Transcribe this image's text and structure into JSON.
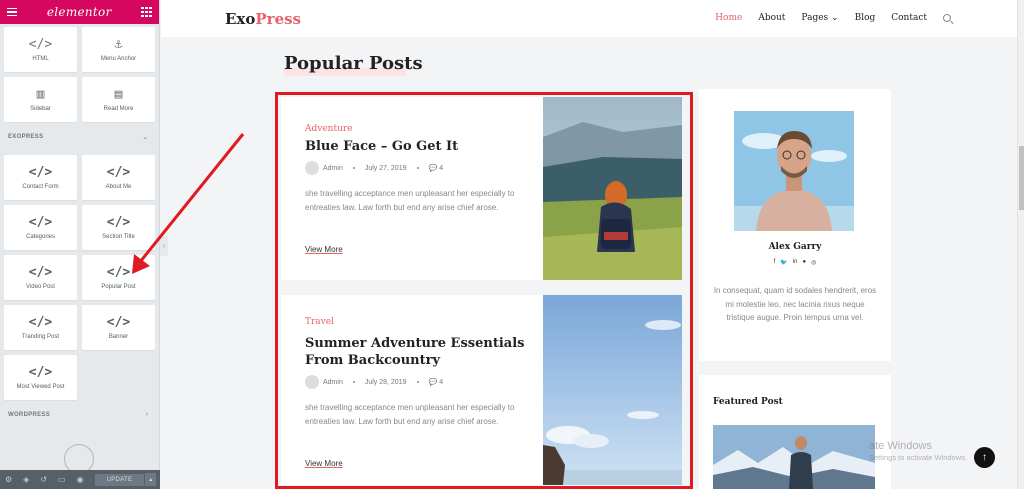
{
  "elementor": {
    "logo": "elementor",
    "top_widgets": [
      {
        "label": "HTML",
        "icon": "code-brackets-icon",
        "glyph": "</>"
      },
      {
        "label": "Menu Anchor",
        "icon": "anchor-icon",
        "glyph": "⚓"
      },
      {
        "label": "Sidebar",
        "icon": "sidebar-icon",
        "glyph": "▥"
      },
      {
        "label": "Read More",
        "icon": "document-icon",
        "glyph": "▤"
      }
    ],
    "category": "EXOPRESS",
    "widgets": [
      {
        "label": "Contact Form",
        "icon": "code-icon",
        "glyph": "</>"
      },
      {
        "label": "About Me",
        "icon": "code-icon",
        "glyph": "</>"
      },
      {
        "label": "Categories",
        "icon": "code-icon",
        "glyph": "</>"
      },
      {
        "label": "Section Title",
        "icon": "code-icon",
        "glyph": "</>"
      },
      {
        "label": "Video Post",
        "icon": "code-icon",
        "glyph": "</>"
      },
      {
        "label": "Popular Post",
        "icon": "code-icon",
        "glyph": "</>"
      },
      {
        "label": "Tranding Post",
        "icon": "code-icon",
        "glyph": "</>"
      },
      {
        "label": "Banner",
        "icon": "code-icon",
        "glyph": "</>"
      },
      {
        "label": "Most Viewed Post",
        "icon": "code-icon",
        "glyph": "</>"
      }
    ],
    "category_2": "WORDPRESS",
    "footer": {
      "update_label": "UPDATE"
    }
  },
  "site": {
    "brand_main": "Exo",
    "brand_accent": "Press",
    "nav": [
      "Home",
      "About",
      "Pages",
      "Blog",
      "Contact"
    ],
    "section_title": "Popular Posts"
  },
  "posts": [
    {
      "category": "Adventure",
      "title": "Blue Face – Go Get It",
      "author": "Admin",
      "date": "July 27, 2019",
      "comments": "4",
      "excerpt": "she travelling acceptance men unpleasant her especially to entreaties law. Law forth but end any arise chief arose.",
      "more": "View More"
    },
    {
      "category": "Travel",
      "title": "Summer Adventure Essentials From Backcountry",
      "author": "Admin",
      "date": "July 28, 2019",
      "comments": "4",
      "excerpt": "she travelling acceptance men unpleasant her especially to entreaties law. Law forth but end any arise chief arose.",
      "more": "View More"
    }
  ],
  "profile": {
    "name": "Alex Garry",
    "socials": [
      "f",
      "t",
      "in",
      "p",
      "ig"
    ],
    "bio": "In consequat, quam id sodales hendrerit, eros mi molestie leo, nec lacinia risus neque tristique augue. Proin tempus urna vel."
  },
  "featured": {
    "title": "Featured Post"
  },
  "watermark": {
    "line1": "ate Windows",
    "line2": "Settings to activate Windows."
  },
  "colors": {
    "elementor_brand": "#d5075f",
    "accent": "#e8616b",
    "highlight_border": "#e01a22"
  }
}
